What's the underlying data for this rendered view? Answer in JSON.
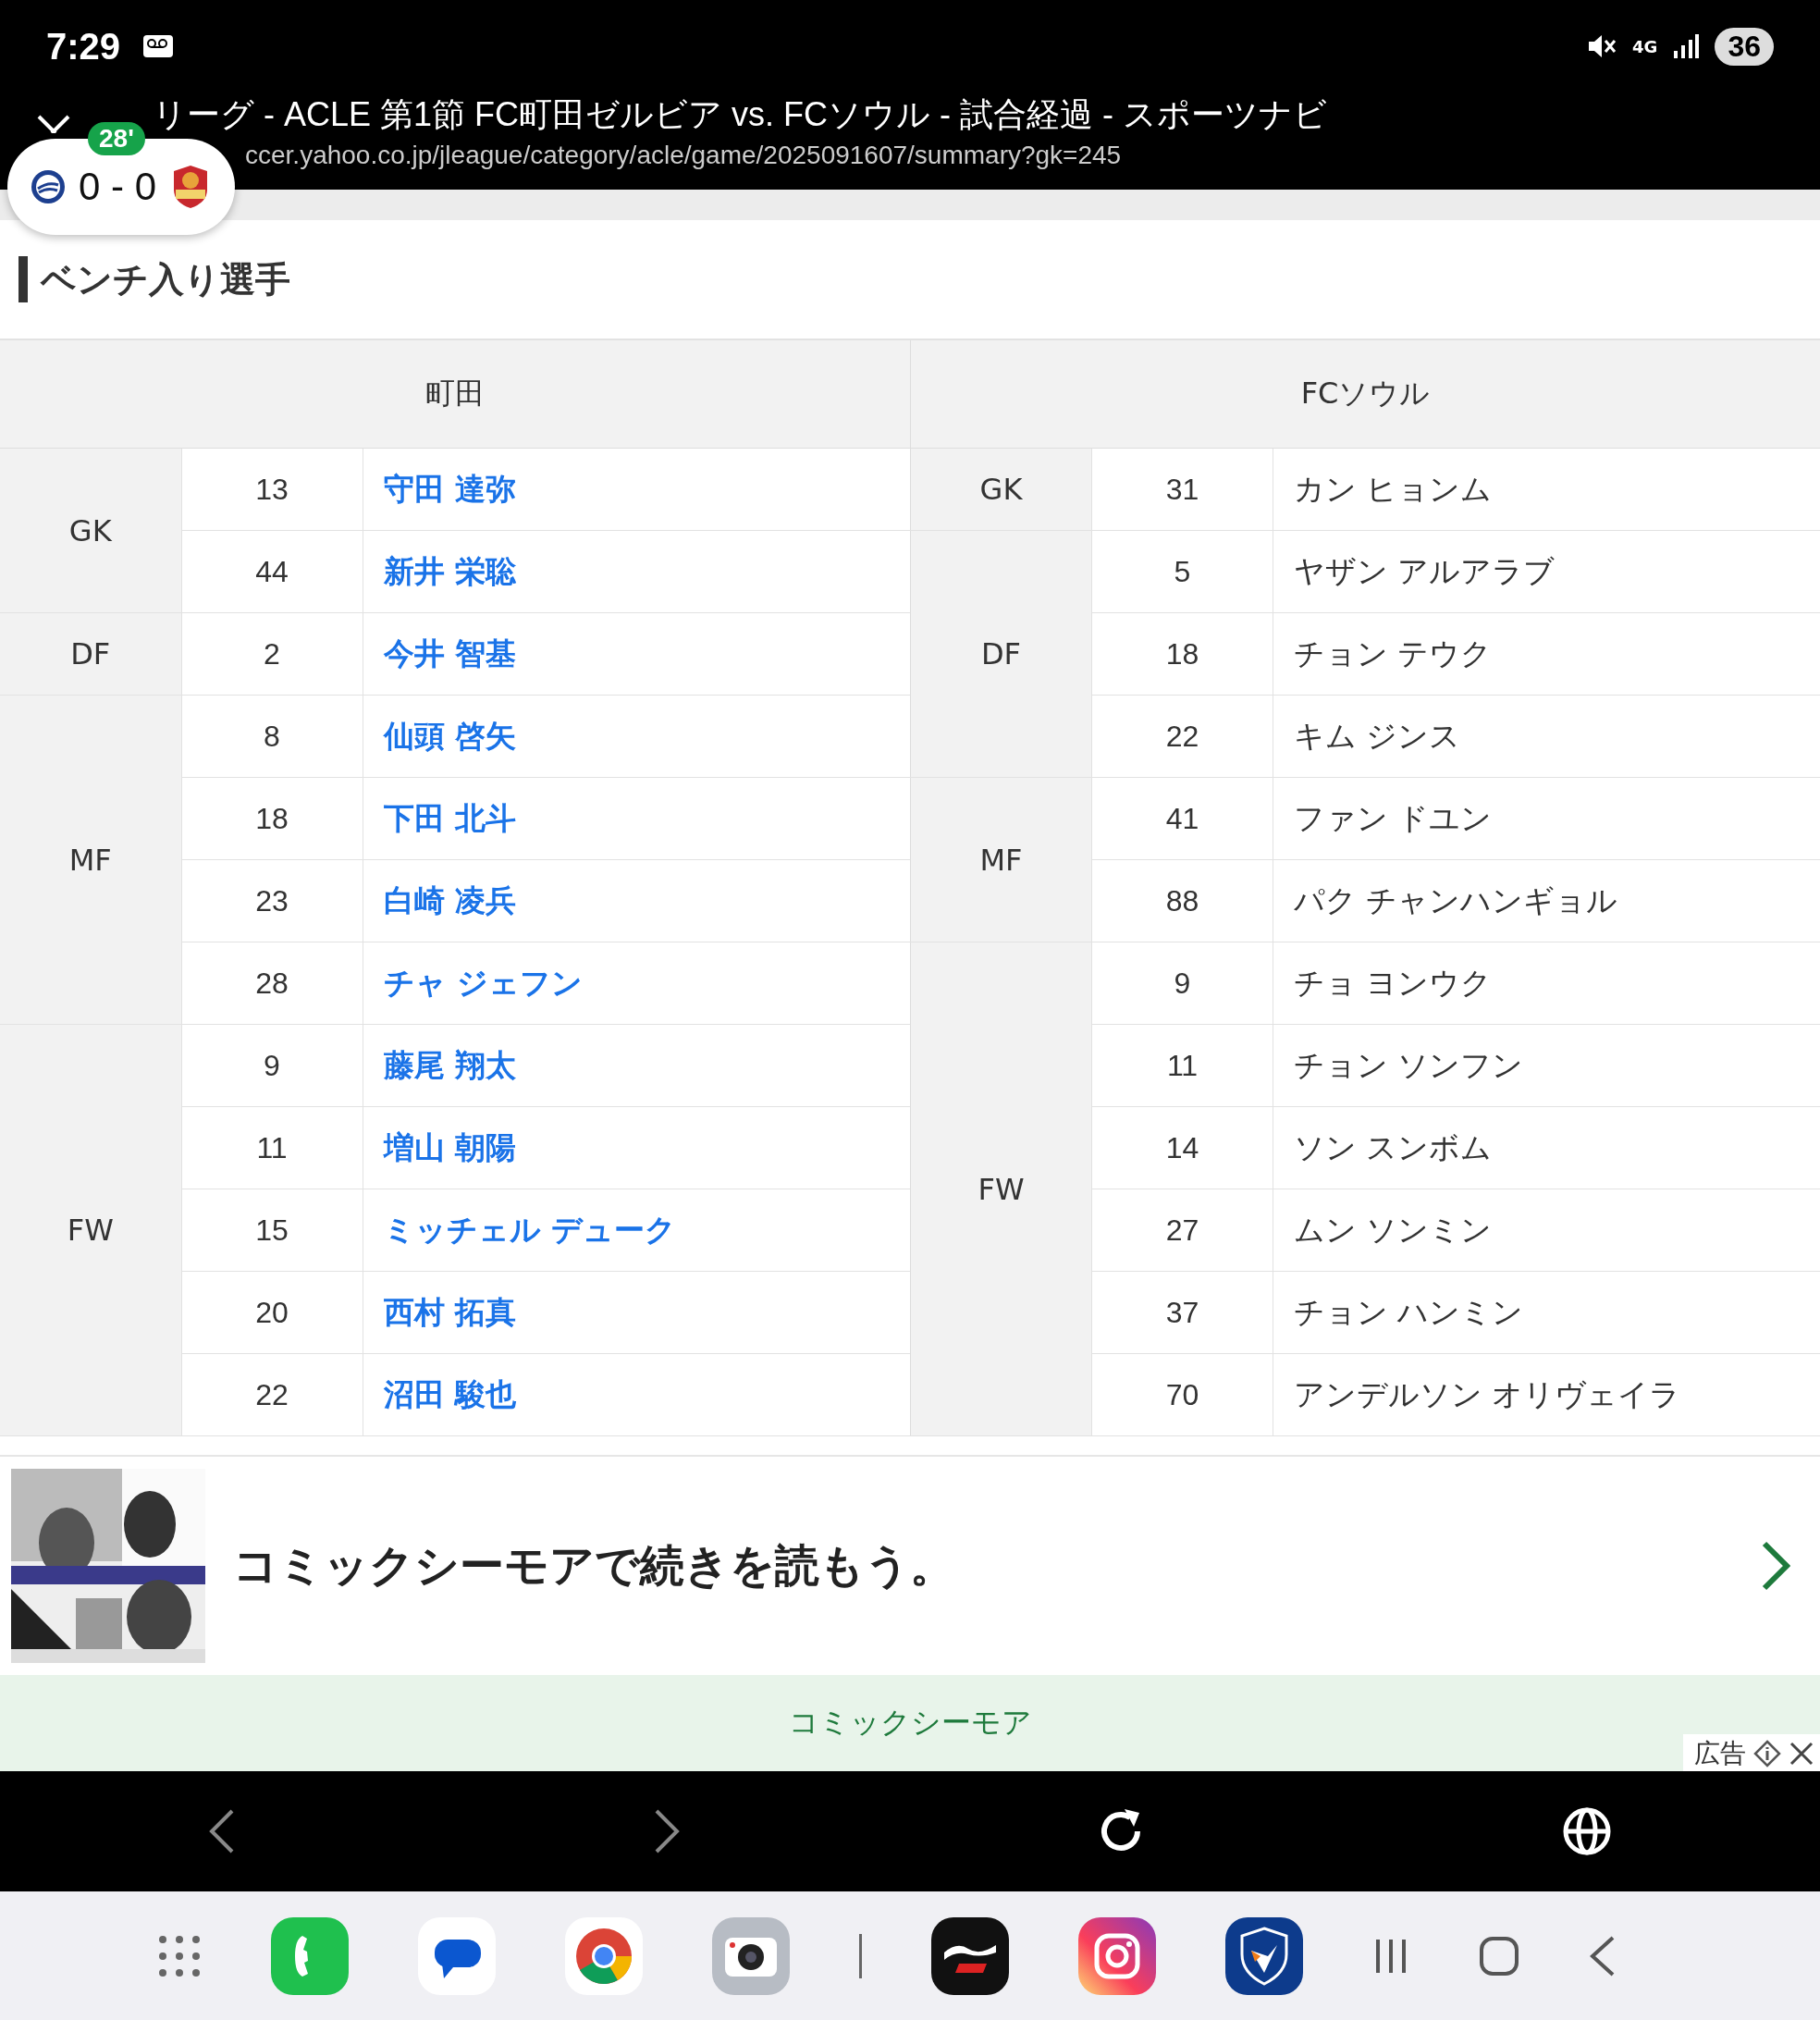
{
  "status_bar": {
    "time": "7:29",
    "network": "4G",
    "battery": "36"
  },
  "browser": {
    "title": "リーグ - ACLE 第1節 FC町田ゼルビア vs. FCソウル - 試合経過 - スポーツナビ",
    "url": "ccer.yahoo.co.jp/jleague/category/acle/game/2025091607/summary?gk=245"
  },
  "score_bubble": {
    "minute": "28'",
    "score": "0 - 0"
  },
  "section": {
    "title": "ベンチ入り選手"
  },
  "teams": [
    {
      "name": "町田",
      "links": true,
      "groups": [
        {
          "position": "GK",
          "players": [
            {
              "number": "13",
              "name": "守田 達弥"
            },
            {
              "number": "44",
              "name": "新井 栄聡"
            }
          ]
        },
        {
          "position": "DF",
          "players": [
            {
              "number": "2",
              "name": "今井 智基"
            }
          ]
        },
        {
          "position": "MF",
          "players": [
            {
              "number": "8",
              "name": "仙頭 啓矢"
            },
            {
              "number": "18",
              "name": "下田 北斗"
            },
            {
              "number": "23",
              "name": "白崎 凌兵"
            },
            {
              "number": "28",
              "name": "チャ ジェフン"
            }
          ]
        },
        {
          "position": "FW",
          "players": [
            {
              "number": "9",
              "name": "藤尾 翔太"
            },
            {
              "number": "11",
              "name": "増山 朝陽"
            },
            {
              "number": "15",
              "name": "ミッチェル デューク"
            },
            {
              "number": "20",
              "name": "西村 拓真"
            },
            {
              "number": "22",
              "name": "沼田 駿也"
            }
          ]
        }
      ]
    },
    {
      "name": "FCソウル",
      "links": false,
      "groups": [
        {
          "position": "GK",
          "players": [
            {
              "number": "31",
              "name": "カン ヒョンム"
            }
          ]
        },
        {
          "position": "DF",
          "players": [
            {
              "number": "5",
              "name": "ヤザン アルアラブ"
            },
            {
              "number": "18",
              "name": "チョン テウク"
            },
            {
              "number": "22",
              "name": "キム ジンス"
            }
          ]
        },
        {
          "position": "MF",
          "players": [
            {
              "number": "41",
              "name": "ファン ドユン"
            },
            {
              "number": "88",
              "name": "パク チャンハンギョル"
            }
          ]
        },
        {
          "position": "FW",
          "players": [
            {
              "number": "9",
              "name": "チョ ヨンウク"
            },
            {
              "number": "11",
              "name": "チョン ソンフン"
            },
            {
              "number": "14",
              "name": "ソン スンボム"
            },
            {
              "number": "27",
              "name": "ムン ソンミン"
            },
            {
              "number": "37",
              "name": "チョン ハンミン"
            },
            {
              "number": "70",
              "name": "アンデルソン オリヴェイラ"
            }
          ]
        }
      ]
    }
  ],
  "ad": {
    "kind": "picture",
    "headline": "コミックシーモアで続きを読もう。",
    "brand": "コミックシーモア",
    "label": "広告"
  }
}
